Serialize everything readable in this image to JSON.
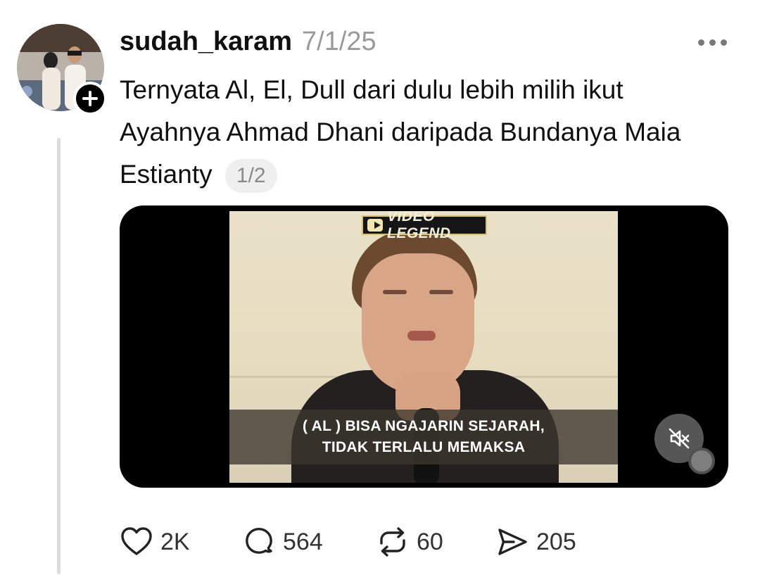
{
  "post": {
    "username": "sudah_karam",
    "timestamp": "7/1/25",
    "text": "Ternyata Al, El, Dull dari dulu lebih milih ikut Ayahnya Ahmad Dhani daripada Bundanya Maia Estianty",
    "page_indicator": "1/2"
  },
  "video": {
    "channel_logo_text": "VIDEO LEGEND",
    "caption_line1": "( AL ) BISA NGAJARIN SEJARAH,",
    "caption_line2": "TIDAK TERLALU MEMAKSA",
    "muted": true
  },
  "actions": {
    "likes": "2K",
    "replies": "564",
    "reposts": "60",
    "shares": "205"
  },
  "icons": [
    "plus-icon",
    "more-icon",
    "mute-icon",
    "heart-icon",
    "comment-icon",
    "repost-icon",
    "share-icon"
  ]
}
